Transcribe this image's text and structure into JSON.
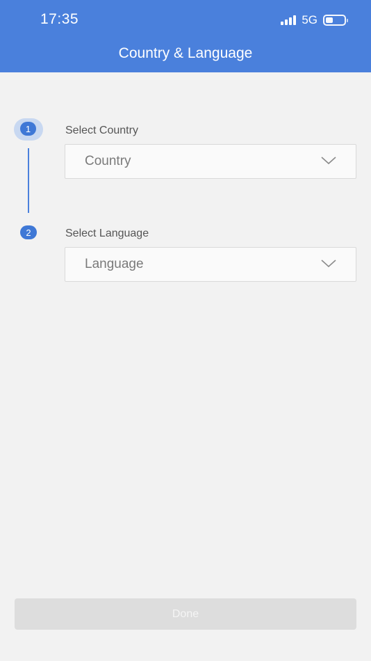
{
  "status_bar": {
    "time": "17:35",
    "network": "5G",
    "signal_icon": "signal-bars-icon",
    "battery_icon": "battery-icon",
    "battery_level": 0.35
  },
  "header": {
    "title": "Country & Language",
    "background_color": "#4a80dc"
  },
  "steps": [
    {
      "number": "1",
      "label": "Select Country",
      "select_placeholder": "Country",
      "icon": "chevron-down-icon"
    },
    {
      "number": "2",
      "label": "Select Language",
      "select_placeholder": "Language",
      "icon": "chevron-down-icon"
    }
  ],
  "footer": {
    "done_label": "Done",
    "done_enabled": false
  },
  "colors": {
    "accent": "#3f78d6",
    "background": "#f2f2f2",
    "disabled_button": "#dddddd"
  }
}
